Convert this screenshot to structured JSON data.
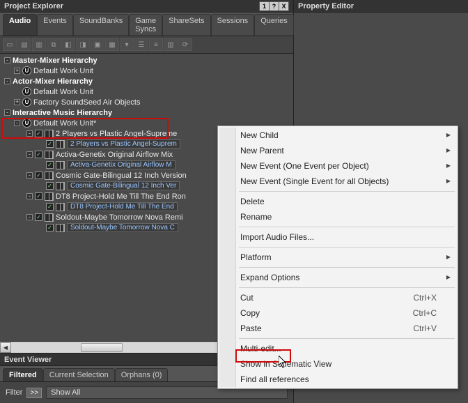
{
  "project_explorer": {
    "title": "Project Explorer",
    "win_buttons": [
      "1",
      "?",
      "X"
    ],
    "tabs": [
      "Audio",
      "Events",
      "SoundBanks",
      "Game Syncs",
      "ShareSets",
      "Sessions",
      "Queries"
    ],
    "active_tab": 0,
    "tree": {
      "master_mixer": {
        "label": "Master-Mixer Hierarchy",
        "children": [
          {
            "label": "Default Work Unit"
          }
        ]
      },
      "actor_mixer": {
        "label": "Actor-Mixer Hierarchy",
        "children": [
          {
            "label": "Default Work Unit"
          },
          {
            "label": "Factory SoundSeed Air Objects"
          }
        ]
      },
      "interactive_music": {
        "label": "Interactive Music Hierarchy",
        "work_unit": {
          "label": "Default Work Unit*"
        },
        "items": [
          {
            "parent": "2 Players vs Plastic Angel-Supreme",
            "child": "2 Players vs Plastic Angel-Suprem"
          },
          {
            "parent": "Activa-Genetix  Original Airflow Mix",
            "child": "Activa-Genetix  Original Airflow M"
          },
          {
            "parent": "Cosmic Gate-Bilingual  12 Inch Version",
            "child": "Cosmic Gate-Bilingual  12 Inch Ver"
          },
          {
            "parent": "DT8 Project-Hold Me Till The End  Ron",
            "child": "DT8 Project-Hold Me Till The End"
          },
          {
            "parent": "Soldout-Maybe Tomorrow  Nova Remi",
            "child": "Soldout-Maybe Tomorrow  Nova C"
          }
        ]
      }
    }
  },
  "property_editor": {
    "title": "Property Editor"
  },
  "event_viewer": {
    "title": "Event Viewer",
    "tabs": [
      "Filtered",
      "Current Selection",
      "Orphans (0)"
    ],
    "active_tab": 0,
    "filter_label": "Filter",
    "filter_btn": ">>",
    "filter_value": "Show All"
  },
  "context_menu": {
    "groups": [
      [
        {
          "label": "New Child",
          "submenu": true
        },
        {
          "label": "New Parent",
          "submenu": true
        },
        {
          "label": "New Event (One Event per Object)",
          "submenu": true
        },
        {
          "label": "New Event (Single Event for all Objects)",
          "submenu": true
        }
      ],
      [
        {
          "label": "Delete"
        },
        {
          "label": "Rename"
        }
      ],
      [
        {
          "label": "Import Audio Files..."
        }
      ],
      [
        {
          "label": "Platform",
          "submenu": true
        }
      ],
      [
        {
          "label": "Expand Options",
          "submenu": true
        }
      ],
      [
        {
          "label": "Cut",
          "shortcut": "Ctrl+X"
        },
        {
          "label": "Copy",
          "shortcut": "Ctrl+C"
        },
        {
          "label": "Paste",
          "shortcut": "Ctrl+V"
        }
      ],
      [
        {
          "label": "Multi-edit...",
          "highlighted": true
        },
        {
          "label": "Show in Schematic View"
        },
        {
          "label": "Find all references"
        }
      ]
    ]
  }
}
